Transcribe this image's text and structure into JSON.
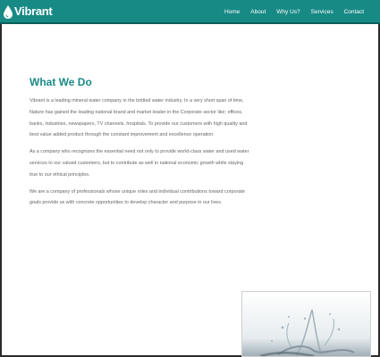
{
  "brand": {
    "name": "Vibrant",
    "logo_icon": "water-drop-icon"
  },
  "nav": {
    "items": [
      "Home",
      "About",
      "Why Us?",
      "Services",
      "Contact"
    ]
  },
  "section": {
    "title": "What We Do",
    "paragraphs": [
      "Vibrant is a leading mineral water company in the bottled water industry. In a very short span of time, Nature has gained the leading national brand and market leader in the Corporate sector like; offices, banks, industries, newspapers, TV channels, hospitals. To provide our customers with high quality and best value added product through the constant improvement and excellence operation.",
      "As a company who recognizes the essential need not only to provide world-class water and used water services to our valued customers, but to contribute as well in national economic growth while staying true to our ethical principles.",
      "We are a company of professionals whose unique roles and individual contributions toward corporate goals provide us with concrete opportunities to develop character and purpose in our lives."
    ]
  },
  "colors": {
    "navbar": "#188a86",
    "accent": "#1c8a86"
  }
}
